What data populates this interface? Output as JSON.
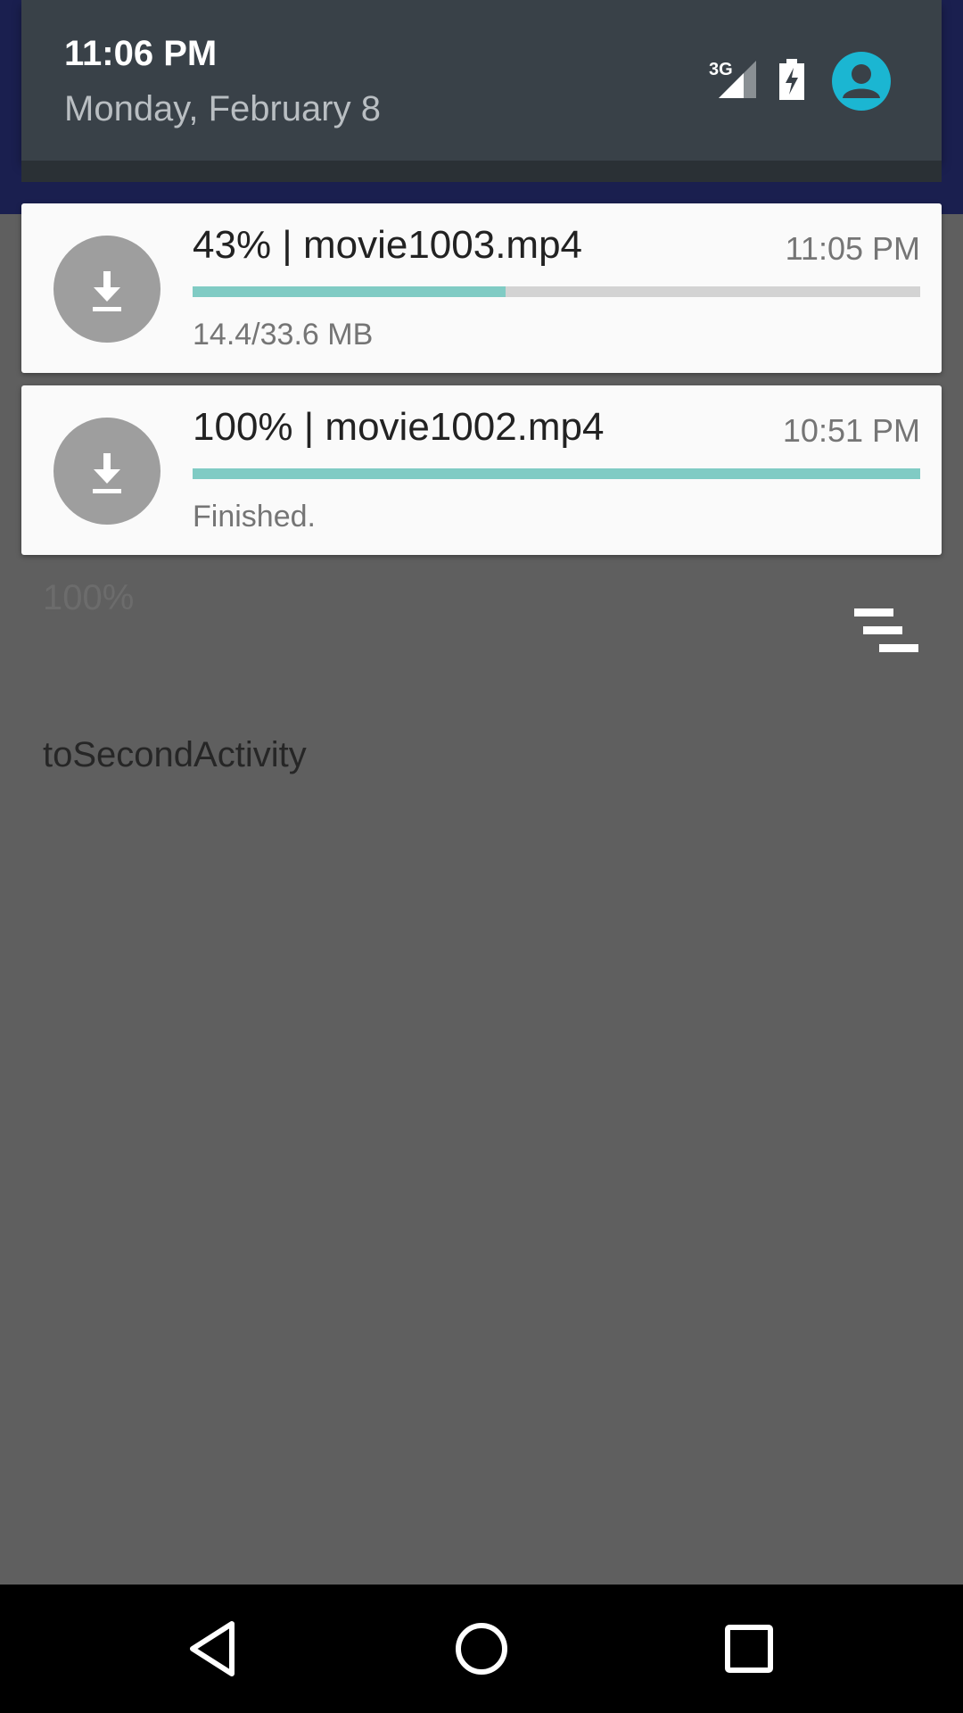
{
  "status_header": {
    "time": "11:06 PM",
    "date": "Monday, February 8",
    "network_type": "3G",
    "icons": [
      "signal-icon",
      "battery-charging-icon",
      "user-avatar-icon"
    ],
    "accent_color": "#1bb6d2"
  },
  "notifications": [
    {
      "icon": "download-icon",
      "title": "43% | movie1003.mp4",
      "time": "11:05 PM",
      "progress": 0.43,
      "status": "14.4/33.6 MB"
    },
    {
      "icon": "download-icon",
      "title": "100% | movie1002.mp4",
      "time": "10:51 PM",
      "progress": 1.0,
      "status": "Finished."
    }
  ],
  "app": {
    "percent_label": "100%",
    "second_activity_label": "toSecondActivity",
    "sort_icon": "sort-lines-icon"
  },
  "nav_bar": {
    "icons": [
      "back-icon",
      "home-icon",
      "recents-icon"
    ]
  },
  "colors": {
    "progress_fill": "#80cbc4",
    "progress_track": "#d3d3d3",
    "shade_header": "#394148"
  }
}
